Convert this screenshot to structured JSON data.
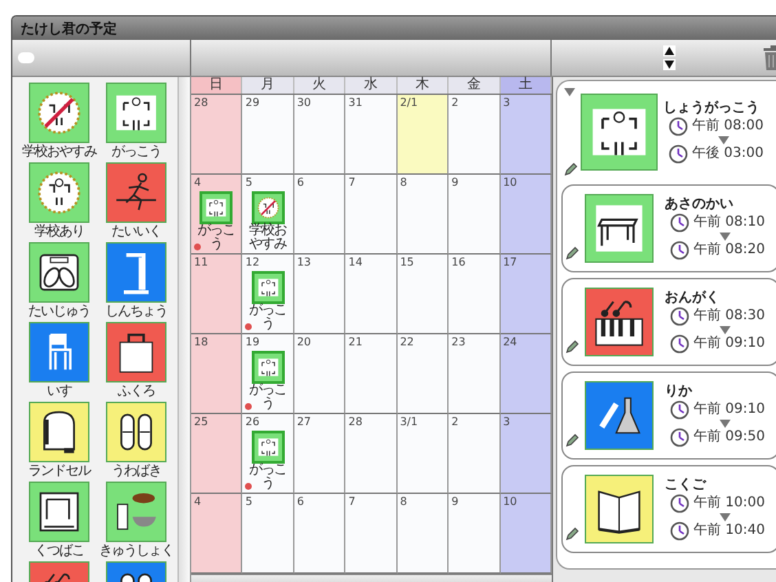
{
  "window": {
    "title": "たけし君の予定"
  },
  "palette": {
    "items": [
      {
        "label": "学校おやすみ",
        "kind": "school-closed",
        "color": "#7ae07a"
      },
      {
        "label": "がっこう",
        "kind": "school",
        "color": "#7ae07a"
      },
      {
        "label": "学校あり",
        "kind": "school-open",
        "color": "#7ae07a"
      },
      {
        "label": "たいいく",
        "kind": "runner",
        "color": "#f05a50"
      },
      {
        "label": "たいじゅう",
        "kind": "scale",
        "color": "#7ae07a"
      },
      {
        "label": "しんちょう",
        "kind": "ruler",
        "color": "#1a7ef0"
      },
      {
        "label": "いす",
        "kind": "chair",
        "color": "#1a7ef0"
      },
      {
        "label": "ふくろ",
        "kind": "bag",
        "color": "#f05a50"
      },
      {
        "label": "ランドセル",
        "kind": "backpack",
        "color": "#f6f07a"
      },
      {
        "label": "うわばき",
        "kind": "shoes",
        "color": "#f6f07a"
      },
      {
        "label": "くつばこ",
        "kind": "shoebox",
        "color": "#7ae07a"
      },
      {
        "label": "きゅうしょく",
        "kind": "lunch",
        "color": "#7ae07a"
      },
      {
        "kind": "music",
        "color": "#f05a50"
      },
      {
        "kind": "shoes",
        "color": "#1a7ef0"
      }
    ]
  },
  "calendar": {
    "weekdays": [
      "日",
      "月",
      "火",
      "水",
      "木",
      "金",
      "土"
    ],
    "weeks": [
      {
        "days": [
          {
            "label": "28",
            "today": false
          },
          {
            "label": "29",
            "today": false
          },
          {
            "label": "30",
            "today": false
          },
          {
            "label": "31",
            "today": false
          },
          {
            "label": "2/1",
            "today": true
          },
          {
            "label": "2",
            "today": false
          },
          {
            "label": "3",
            "today": false
          }
        ]
      },
      {
        "days": [
          {
            "label": "4",
            "today": false,
            "events": [
              {
                "label": "がっこう",
                "kind": "school",
                "dot": true
              }
            ]
          },
          {
            "label": "5",
            "today": false,
            "events": [
              {
                "label": "学校おやすみ",
                "kind": "school-closed",
                "dot": false
              }
            ]
          },
          {
            "label": "6",
            "today": false
          },
          {
            "label": "7",
            "today": false
          },
          {
            "label": "8",
            "today": false
          },
          {
            "label": "9",
            "today": false
          },
          {
            "label": "10",
            "today": false
          }
        ]
      },
      {
        "days": [
          {
            "label": "11",
            "today": false
          },
          {
            "label": "12",
            "today": false,
            "events": [
              {
                "label": "がっこう",
                "kind": "school",
                "dot": true
              }
            ]
          },
          {
            "label": "13",
            "today": false
          },
          {
            "label": "14",
            "today": false
          },
          {
            "label": "15",
            "today": false
          },
          {
            "label": "16",
            "today": false
          },
          {
            "label": "17",
            "today": false
          }
        ]
      },
      {
        "days": [
          {
            "label": "18",
            "today": false
          },
          {
            "label": "19",
            "today": false,
            "events": [
              {
                "label": "がっこう",
                "kind": "school",
                "dot": true
              }
            ]
          },
          {
            "label": "20",
            "today": false
          },
          {
            "label": "21",
            "today": false
          },
          {
            "label": "22",
            "today": false
          },
          {
            "label": "23",
            "today": false
          },
          {
            "label": "24",
            "today": false
          }
        ]
      },
      {
        "days": [
          {
            "label": "25",
            "today": false
          },
          {
            "label": "26",
            "today": false,
            "events": [
              {
                "label": "がっこう",
                "kind": "school",
                "dot": true
              }
            ]
          },
          {
            "label": "27",
            "today": false
          },
          {
            "label": "28",
            "today": false
          },
          {
            "label": "3/1",
            "today": false
          },
          {
            "label": "2",
            "today": false
          },
          {
            "label": "3",
            "today": false
          }
        ]
      },
      {
        "days": [
          {
            "label": "4",
            "today": false
          },
          {
            "label": "5",
            "today": false
          },
          {
            "label": "6",
            "today": false
          },
          {
            "label": "7",
            "today": false
          },
          {
            "label": "8",
            "today": false
          },
          {
            "label": "9",
            "today": false
          },
          {
            "label": "10",
            "today": false
          }
        ]
      }
    ]
  },
  "schedule": {
    "title": "しょうがっこう",
    "kind": "school",
    "color": "#7ae07a",
    "start": "午前 08:00",
    "end": "午後 03:00",
    "expanded": true,
    "children": [
      {
        "title": "あさのかい",
        "kind": "desk",
        "color": "#7ae07a",
        "start": "午前 08:10",
        "end": "午前 08:20"
      },
      {
        "title": "おんがく",
        "kind": "music",
        "color": "#f05a50",
        "start": "午前 08:30",
        "end": "午前 09:10"
      },
      {
        "title": "りか",
        "kind": "science",
        "color": "#1a7ef0",
        "start": "午前 09:10",
        "end": "午前 09:50"
      },
      {
        "title": "こくご",
        "kind": "book",
        "color": "#f6f07a",
        "start": "午前 10:00",
        "end": "午前 10:40"
      }
    ]
  }
}
